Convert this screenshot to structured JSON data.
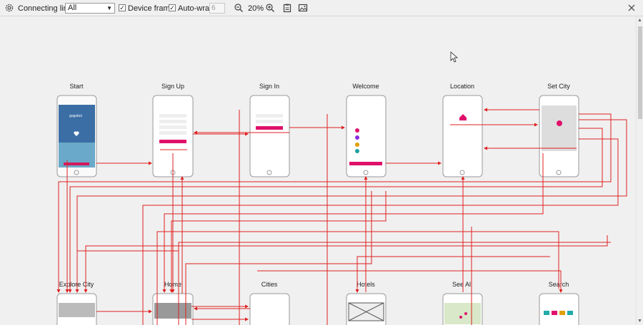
{
  "toolbar": {
    "connecting_lines_label": "Connecting lines",
    "filter_value": "All",
    "device_frame_label": "Device frame",
    "auto_wrap_label": "Auto-wrap",
    "wrap_count": "6",
    "zoom_level": "20%"
  },
  "screens": {
    "row1": [
      "Start",
      "Sign Up",
      "Sign In",
      "Welcome",
      "Location",
      "Set City"
    ],
    "row2": [
      "Explore City",
      "Home",
      "Cities",
      "Hotels",
      "See All",
      "Search"
    ]
  },
  "colors": {
    "line": "#e02020",
    "accent": "#e0106a"
  },
  "icons": [
    "gear-icon",
    "zoom-out-icon",
    "zoom-in-icon",
    "clipboard-icon",
    "image-export-icon",
    "close-icon",
    "mouse-cursor-icon"
  ]
}
